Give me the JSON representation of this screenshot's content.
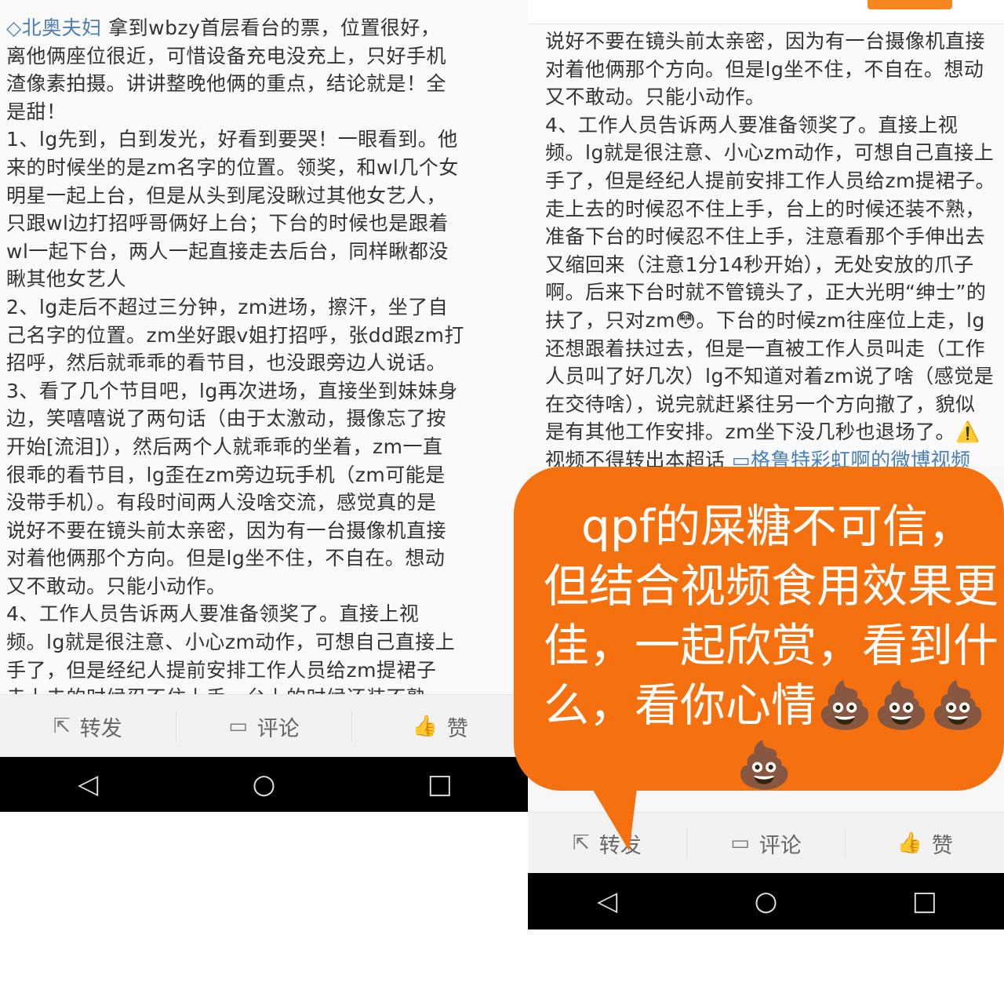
{
  "left": {
    "username": "◇北奥夫妇",
    "first_line_rest": " 拿到wbzy首层看台的票，位置很好，",
    "lines": [
      "离他俩座位很近，可惜设备充电没充上，只好手机",
      "渣像素拍摄。讲讲整晚他俩的重点，结论就是！全",
      "是甜！",
      "1、lg先到，白到发光，好看到要哭！一眼看到。他",
      "来的时候坐的是zm名字的位置。领奖，和wl几个女",
      "明星一起上台，但是从头到尾没瞅过其他女艺人，",
      "只跟wl边打招呼哥俩好上台；下台的时候也是跟着",
      "wl一起下台，两人一起直接走去后台，同样瞅都没",
      "瞅其他女艺人",
      "2、lg走后不超过三分钟，zm进场，擦汗，坐了自",
      "己名字的位置。zm坐好跟v姐打招呼，张dd跟zm打",
      "招呼，然后就乖乖的看节目，也没跟旁边人说话。",
      "3、看了几个节目吧，lg再次进场，直接坐到妹妹身",
      "边，笑嘻嘻说了两句话（由于太激动，摄像忘了按",
      "开始[流泪]），然后两个人就乖乖的坐着，zm一直",
      "很乖的看节目，lg歪在zm旁边玩手机（zm可能是",
      "没带手机）。有段时间两人没啥交流，感觉真的是",
      "说好不要在镜头前太亲密，因为有一台摄像机直接",
      "对着他俩那个方向。但是lg坐不住，不自在。想动",
      "又不敢动。只能小动作。",
      "4、工作人员告诉两人要准备领奖了。直接上视",
      "频。lg就是很注意、小心zm动作，可想自己直接上",
      "手了，但是经纪人提前安排工作人员给zm提裙子",
      "走上去的时候忍不住上手，台上的时候还装不熟"
    ],
    "actions": {
      "repost": "转发",
      "comment": "评论",
      "like": "赞"
    }
  },
  "right": {
    "lines": [
      "说好不要在镜头前太亲密，因为有一台摄像机直接",
      "对着他俩那个方向。但是lg坐不住，不自在。想动",
      "又不敢动。只能小动作。",
      "4、工作人员告诉两人要准备领奖了。直接上视",
      "频。lg就是很注意、小心zm动作，可想自己直接上",
      "手了，但是经纪人提前安排工作人员给zm提裙子。",
      "走上去的时候忍不住上手，台上的时候还装不熟，",
      "准备下台的时候忍不住上手，注意看那个手伸出去",
      "又缩回来（注意1分14秒开始），无处安放的爪子",
      "啊。后来下台时就不管镜头了，正大光明“绅士”的",
      "扶了，只对zm😳。下台的时候zm往座位上走，lg",
      "还想跟着扶过去，但是一直被工作人员叫走（工作",
      "人员叫了好几次）lg不知道对着zm说了啥（感觉是",
      "在交待啥），说完就赶紧往另一个方向撤了，貌似",
      "是有其他工作安排。zm坐下没几秒也退场了。⚠️"
    ],
    "last_line_text": "视频不得转出本超话 ",
    "video_link": "▭格鲁特彩虹啊的微博视频",
    "actions": {
      "repost": "转发",
      "comment": "评论",
      "like": "赞"
    }
  },
  "bubble": {
    "lines": [
      "qpf的屎糖不可信，",
      "但结合视频食用效果更",
      "佳，一起欣赏，看到什",
      "么，看你心情💩💩💩",
      "💩"
    ],
    "color": "#f5700f"
  }
}
